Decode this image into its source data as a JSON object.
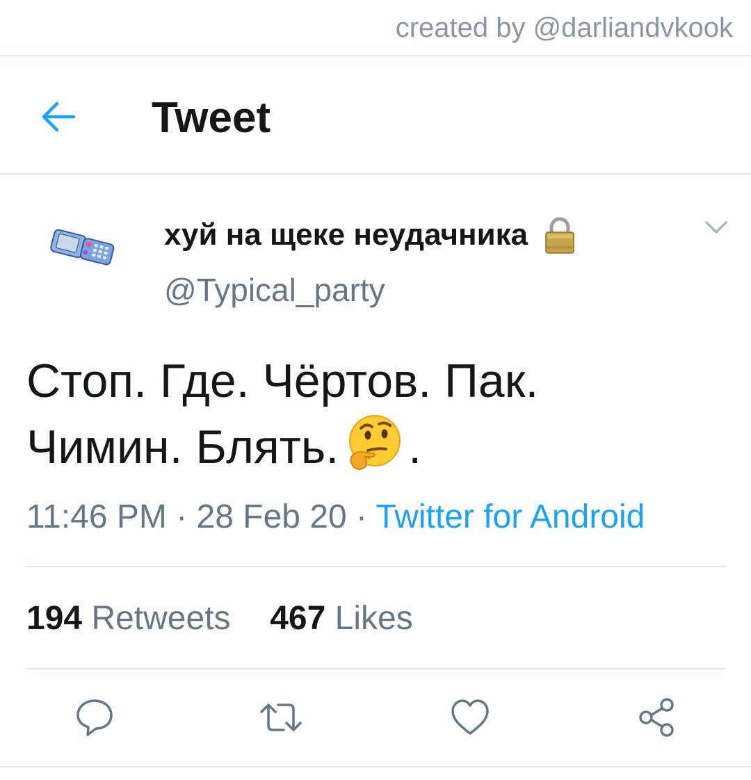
{
  "watermark": {
    "text": "created by @darliandvkook"
  },
  "header": {
    "title": "Tweet"
  },
  "tweet": {
    "display_name": "хуй на щеке неудачника",
    "handle": "@Typical_party",
    "text_line1": "Стоп. Где. Чёртов. Пак.",
    "text_line2_start": "Чимин. Блять.",
    "text_line2_end": ".",
    "emoji": "thinking-face",
    "time": "11:46 PM",
    "separator1": " · ",
    "date": "28 Feb 20",
    "separator2": " · ",
    "source": "Twitter for Android",
    "retweets_count": "194",
    "retweets_label": "Retweets",
    "likes_count": "467",
    "likes_label": "Likes"
  },
  "colors": {
    "accent": "#1da1f2",
    "text": "#14171a",
    "secondary": "#657786",
    "divider": "#e1e8ed"
  }
}
